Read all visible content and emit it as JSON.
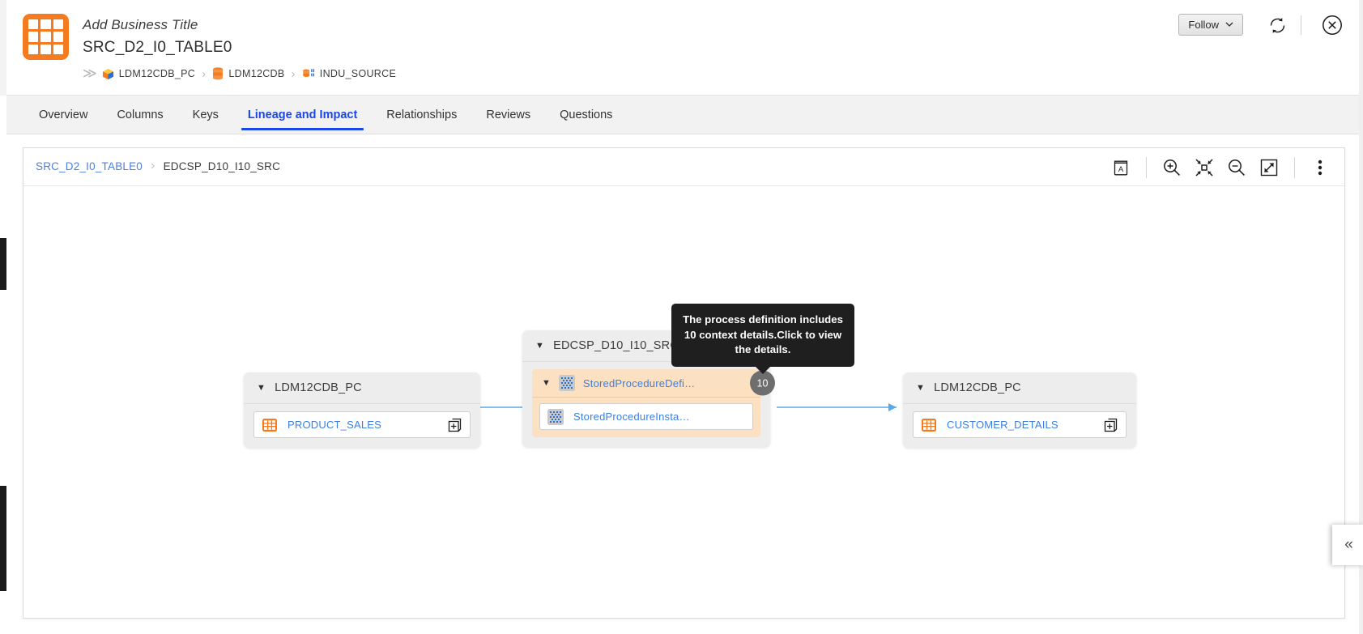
{
  "header": {
    "business_title": "Add Business Title",
    "asset_name": "SRC_D2_I0_TABLE0",
    "asset_icon": "table-icon",
    "breadcrumb_lead": "≫",
    "breadcrumbs": [
      {
        "label": "LDM12CDB_PC",
        "icon": "cube-icon"
      },
      {
        "label": "LDM12CDB",
        "icon": "database-icon"
      },
      {
        "label": "INDU_SOURCE",
        "icon": "schema-icon"
      }
    ],
    "separator": "›",
    "follow_label": "Follow",
    "follow_caret": "⌄",
    "refresh_icon": "refresh-icon",
    "close_icon": "close-circle-icon"
  },
  "tabs": [
    {
      "label": "Overview",
      "active": false
    },
    {
      "label": "Columns",
      "active": false
    },
    {
      "label": "Keys",
      "active": false
    },
    {
      "label": "Lineage and Impact",
      "active": true
    },
    {
      "label": "Relationships",
      "active": false
    },
    {
      "label": "Reviews",
      "active": false
    },
    {
      "label": "Questions",
      "active": false
    }
  ],
  "lineage": {
    "breadcrumb": {
      "root": "SRC_D2_I0_TABLE0",
      "chevron": "›",
      "current": "EDCSP_D10_I10_SRC"
    },
    "tools": [
      {
        "name": "glossary-icon",
        "title": "Glossary"
      },
      {
        "name": "zoom-in-icon",
        "title": "Zoom In"
      },
      {
        "name": "fit-to-screen-icon",
        "title": "Fit to Screen"
      },
      {
        "name": "zoom-out-icon",
        "title": "Zoom Out"
      },
      {
        "name": "expand-icon",
        "title": "Expand"
      },
      {
        "name": "more-menu-icon",
        "title": "More"
      }
    ],
    "nodes": {
      "source": {
        "caret": "▼",
        "title": "LDM12CDB_PC",
        "leaf": {
          "label": "PRODUCT_SALES",
          "icon": "table-icon",
          "action_icon": "add-to-copy-icon"
        }
      },
      "process": {
        "caret": "▼",
        "title": "EDCSP_D10_I10_SRC",
        "definition": {
          "caret": "▼",
          "label": "StoredProcedureDefi…",
          "icon": "stored-procedure-icon",
          "badge_count": "10"
        },
        "instance": {
          "label": "StoredProcedureInsta…",
          "icon": "stored-procedure-icon"
        }
      },
      "target": {
        "caret": "▼",
        "title": "LDM12CDB_PC",
        "leaf": {
          "label": "CUSTOMER_DETAILS",
          "icon": "table-icon",
          "action_icon": "add-to-copy-icon"
        }
      }
    },
    "tooltip": "The process definition includes 10 context details.Click to view the details.",
    "collapse_handle": "«"
  },
  "colors": {
    "accent_orange": "#f47b20",
    "link_blue": "#3b7fe4",
    "tab_active_blue": "#1a47e8",
    "process_peach": "#fce0c2",
    "group_grey": "#ededed",
    "badge_grey": "#6e6e6e",
    "edge_blue": "#5aa9e6"
  }
}
